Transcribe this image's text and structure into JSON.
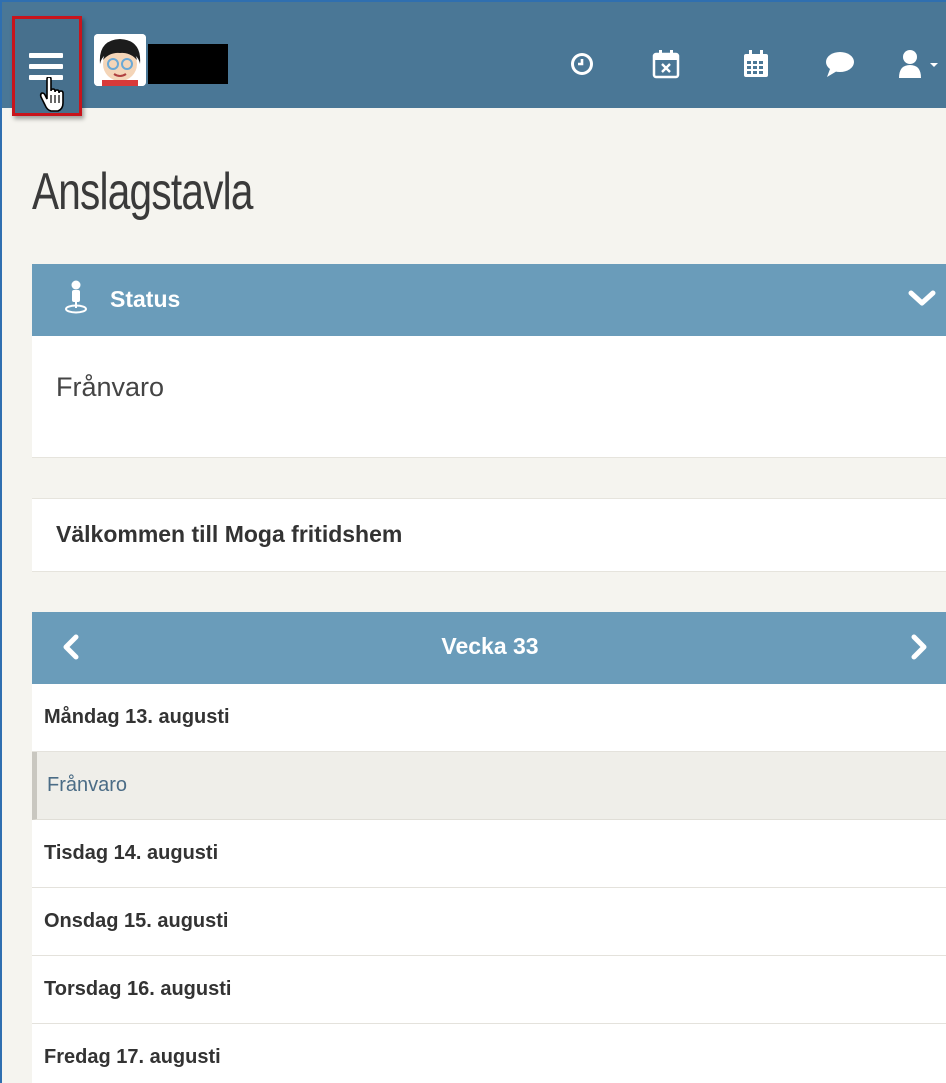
{
  "header": {
    "menu_icon": "hamburger-menu-icon",
    "icons": [
      "clock-icon",
      "calendar-x-icon",
      "calendar-icon",
      "chat-bubble-icon",
      "user-icon"
    ]
  },
  "page": {
    "title": "Anslagstavla"
  },
  "status_panel": {
    "heading": "Status",
    "value": "Frånvaro"
  },
  "welcome": {
    "text": "Välkommen till Moga fritidshem"
  },
  "week_panel": {
    "heading": "Vecka 33",
    "days": [
      {
        "label": "Måndag 13. augusti",
        "entries": [
          "Frånvaro"
        ]
      },
      {
        "label": "Tisdag 14. augusti",
        "entries": []
      },
      {
        "label": "Onsdag 15. augusti",
        "entries": []
      },
      {
        "label": "Torsdag 16. augusti",
        "entries": []
      },
      {
        "label": "Fredag 17. augusti",
        "entries": []
      }
    ]
  },
  "colors": {
    "topbar": "#4a7796",
    "panel_header": "#6a9cba",
    "highlight_border": "#c8141c",
    "page_background": "#f5f4ef"
  }
}
